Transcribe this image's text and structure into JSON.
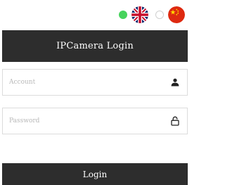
{
  "language": {
    "options": [
      {
        "icon": "uk-flag-icon",
        "selected": true
      },
      {
        "icon": "china-flag-icon",
        "selected": false
      }
    ]
  },
  "header": {
    "title": "IPCamera Login"
  },
  "form": {
    "account": {
      "placeholder": "Account",
      "value": "",
      "icon": "user-icon"
    },
    "password": {
      "placeholder": "Password",
      "value": "",
      "icon": "unlock-icon"
    }
  },
  "login_button": {
    "label": "Login"
  },
  "colors": {
    "header_bg": "#2d2d2d",
    "radio_selected": "#46d35c",
    "text_on_dark": "#ffffff"
  }
}
